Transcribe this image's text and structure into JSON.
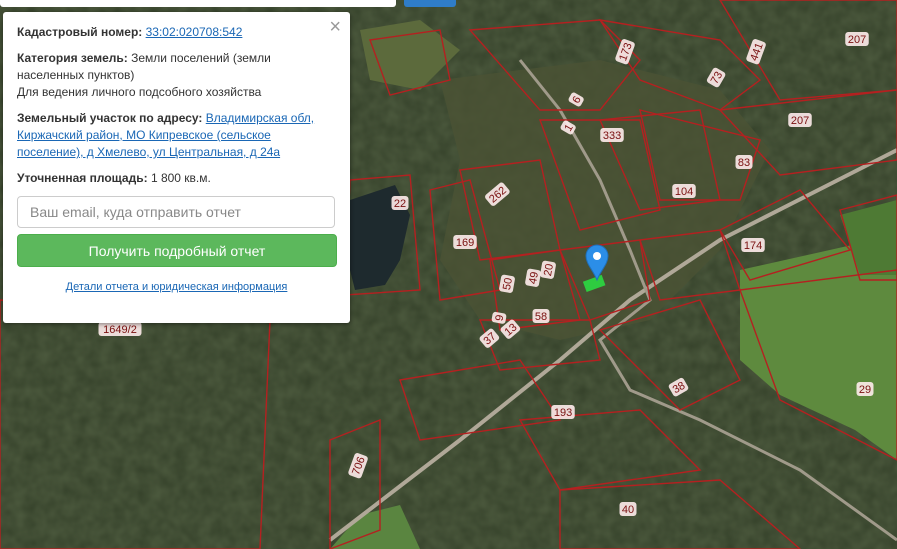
{
  "popup": {
    "close_symbol": "×",
    "cadastral_label": "Кадастровый номер:",
    "cadastral_number": "33:02:020708:542",
    "category_label": "Категория земель:",
    "category_value": "Земли поселений (земли населенных пунктов)",
    "usage": "Для ведения личного подсобного хозяйства",
    "address_label": "Земельный участок по адресу:",
    "address_value": "Владимирская обл, Киржачский район, МО Кипревское (сельское поселение), д Хмелево, ул Центральная, д 24а",
    "area_label": "Уточненная площадь:",
    "area_value": "1 800 кв.м.",
    "email_placeholder": "Ваш email, куда отправить отчет",
    "submit_label": "Получить подробный отчет",
    "details_link": "Детали отчета и юридическая информация"
  },
  "map": {
    "parcel_labels": [
      "173",
      "441",
      "207",
      "73",
      "333",
      "207",
      "83",
      "262",
      "104",
      "174",
      "22",
      "169",
      "50",
      "49",
      "20",
      "58",
      "9",
      "13",
      "37",
      "1649/2",
      "38",
      "193",
      "29",
      "706",
      "40",
      "1",
      "6"
    ],
    "parcel_color": "#b52020",
    "marker_color": "#2b8ee8",
    "selected_parcel_color": "#2ecc40"
  }
}
